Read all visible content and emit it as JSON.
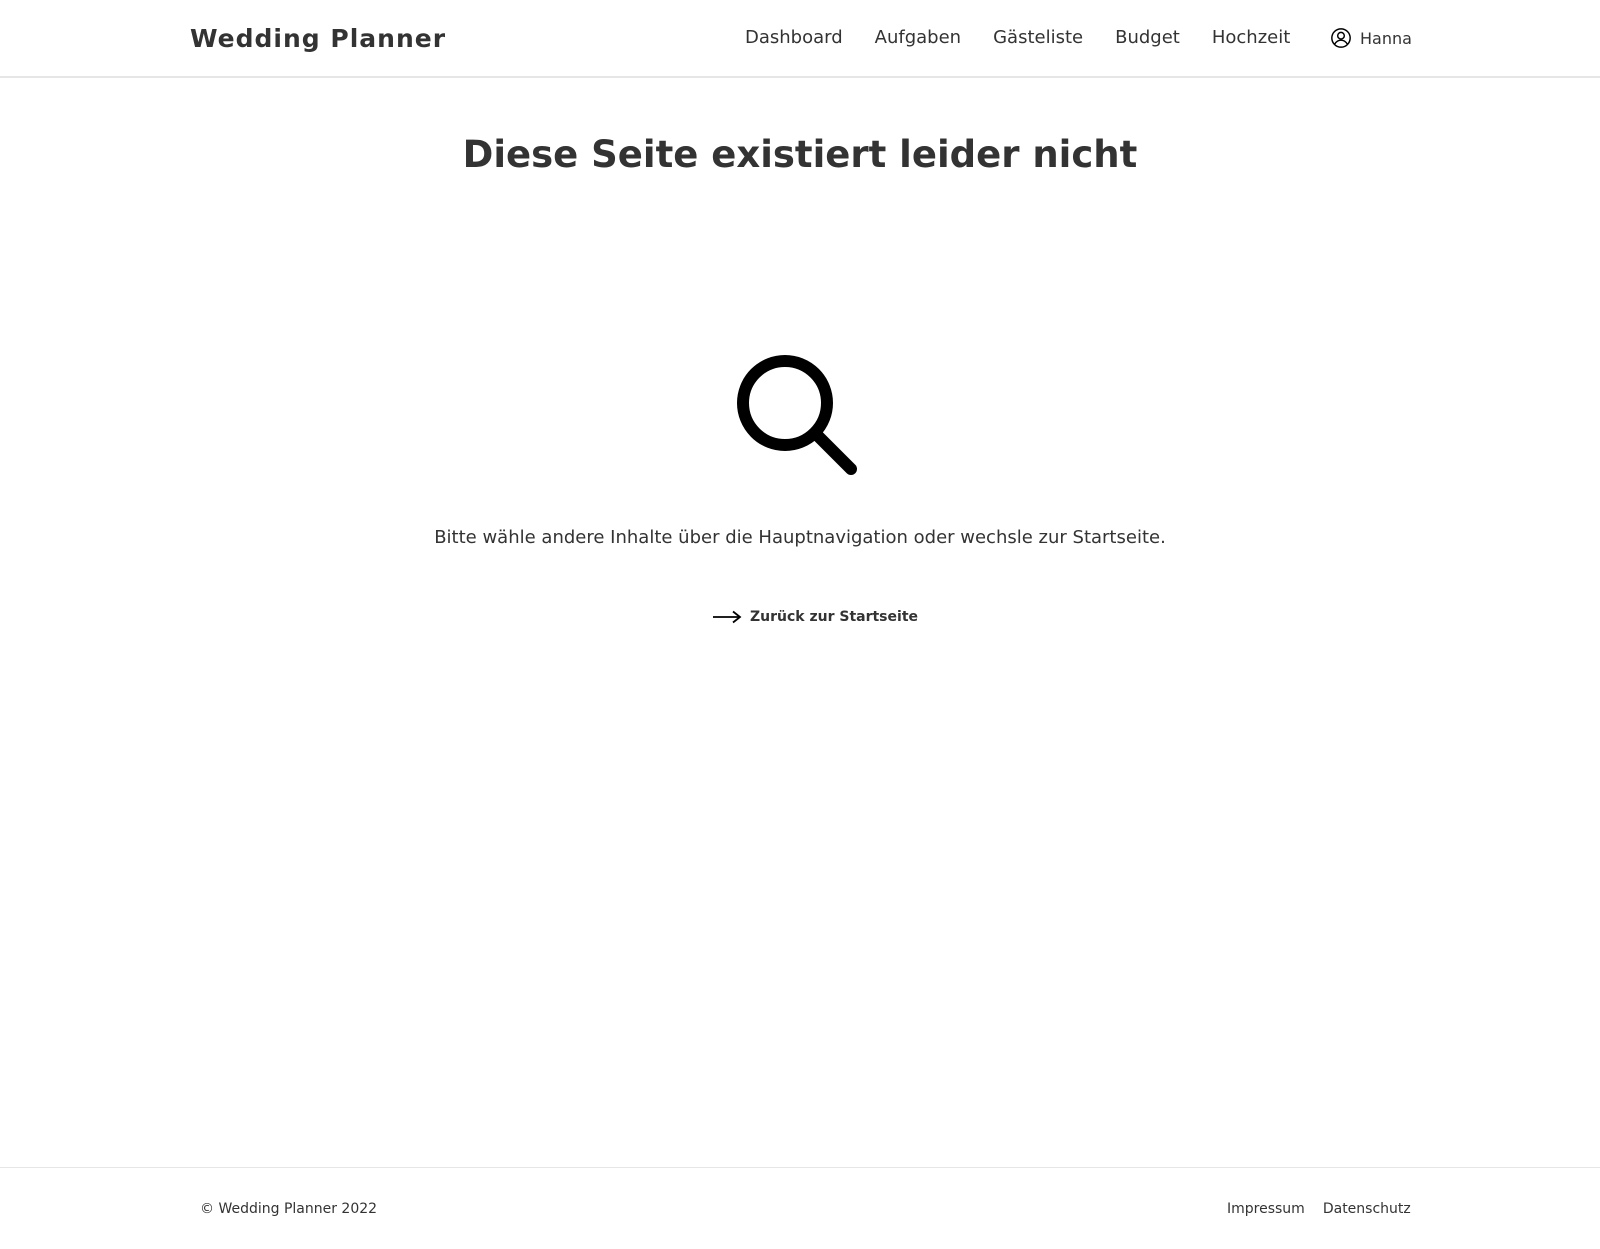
{
  "header": {
    "brand": "Wedding Planner",
    "nav": {
      "dashboard": "Dashboard",
      "tasks": "Aufgaben",
      "guests": "Gästeliste",
      "budget": "Budget",
      "wedding": "Hochzeit"
    },
    "user": {
      "name": "Hanna",
      "icon": "user-circle-icon"
    }
  },
  "main": {
    "title": "Diese Seite existiert leider nicht",
    "illustration_icon": "magnifier-icon",
    "hint": "Bitte wähle andere Inhalte über die Hauptnavigation oder wechsle zur Startseite.",
    "back_link": {
      "label": "Zurück zur Startseite",
      "icon": "arrow-right-icon"
    }
  },
  "footer": {
    "copyright": "© Wedding Planner 2022",
    "links": {
      "imprint": "Impressum",
      "privacy": "Datenschutz"
    }
  },
  "colors": {
    "text": "#333333",
    "icon": "#000000",
    "divider": "#e6e6e6",
    "background": "#ffffff"
  }
}
